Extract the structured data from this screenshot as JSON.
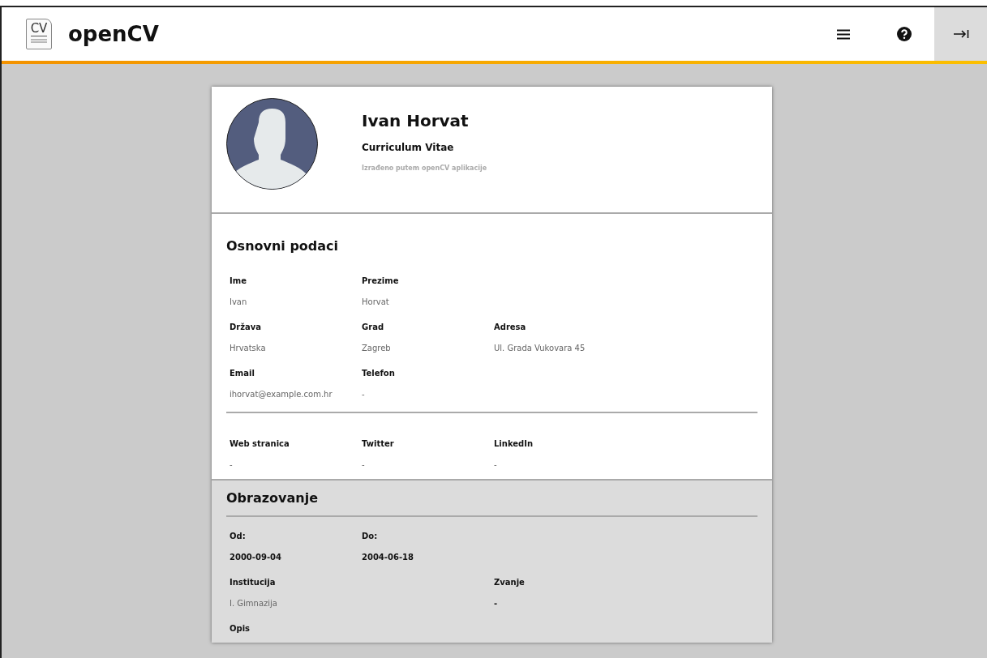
{
  "app": {
    "logo_text": "CV",
    "title": "openCV"
  },
  "toolbar": {
    "collapse_selected": true
  },
  "profile": {
    "name": "Ivan Horvat",
    "subtitle": "Curriculum Vitae",
    "note": "Izrađeno putem openCV aplikacije"
  },
  "basic_info": {
    "title": "Osnovni podaci",
    "rows": [
      [
        {
          "label": "Ime",
          "value": "Ivan"
        },
        {
          "label": "Prezime",
          "value": "Horvat"
        }
      ],
      [
        {
          "label": "Država",
          "value": "Hrvatska"
        },
        {
          "label": "Grad",
          "value": "Zagreb"
        },
        {
          "label": "Adresa",
          "value": "Ul. Grada Vukovara 45"
        }
      ],
      [
        {
          "label": "Email",
          "value": "ihorvat@example.com.hr"
        },
        {
          "label": "Telefon",
          "value": "-"
        }
      ]
    ],
    "web_rows": [
      [
        {
          "label": "Web stranica",
          "value": "-"
        },
        {
          "label": "Twitter",
          "value": "-"
        },
        {
          "label": "LinkedIn",
          "value": "-"
        }
      ]
    ]
  },
  "education": {
    "title": "Obrazovanje",
    "rows": [
      {
        "kind": "adjacent",
        "cells": [
          {
            "label": "Od:",
            "value": "2000-09-04",
            "bold": true
          },
          {
            "label": "Do:",
            "value": "2004-06-18",
            "bold": true
          }
        ]
      },
      {
        "kind": "split",
        "cells": [
          {
            "label": "Institucija",
            "value": "I. Gimnazija",
            "bold": false
          },
          {
            "label": "Zvanje",
            "value": "-",
            "bold": true
          }
        ]
      },
      {
        "kind": "adjacent",
        "cells": [
          {
            "label": "Opis"
          }
        ]
      }
    ]
  }
}
